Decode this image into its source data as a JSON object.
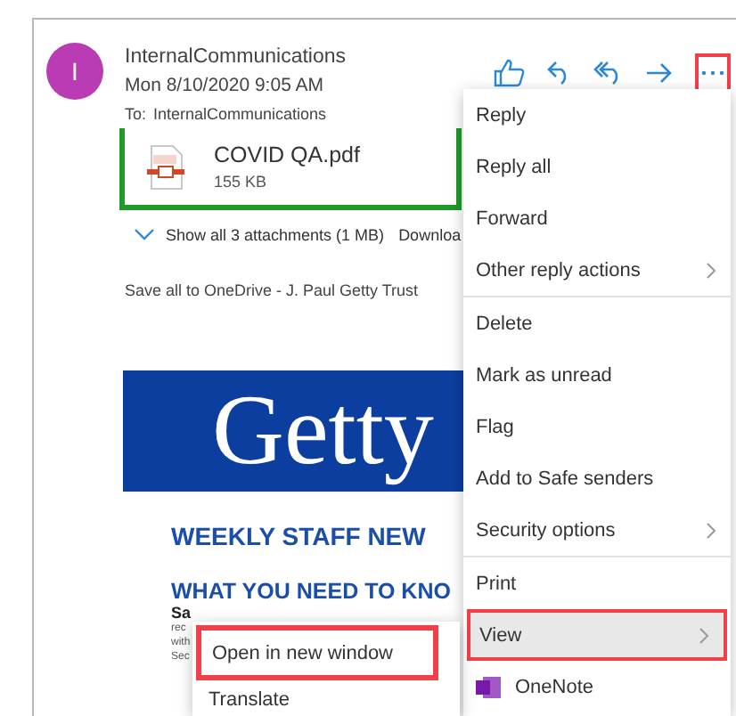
{
  "message": {
    "avatar_initial": "I",
    "sender": "InternalCommunications",
    "date": "Mon 8/10/2020 9:05 AM",
    "to_label": "To:",
    "to": "InternalCommunications"
  },
  "more_button": {
    "highlighted": true
  },
  "attachment": {
    "name": "COVID QA.pdf",
    "size": "155 KB",
    "highlighted": true
  },
  "attachments_link": "Show all 3 attachments (1 MB)",
  "download_link": "Downloa",
  "save_all": "Save all to OneDrive - J. Paul Getty Trust",
  "banner": "Getty",
  "heading": "WEEKLY STAFF NEW",
  "subheading": "WHAT YOU NEED TO KNO",
  "body_lines": [
    {
      "text": "Sa",
      "bold": true
    },
    {
      "text": "rec",
      "bold": false
    },
    {
      "text": "with",
      "bold": false
    },
    {
      "text": "Sec",
      "bold": false
    }
  ],
  "menu": {
    "groups": [
      [
        {
          "label": "Reply",
          "submenu": false,
          "highlighted": false,
          "kind": "text"
        },
        {
          "label": "Reply all",
          "submenu": false,
          "highlighted": false,
          "kind": "text"
        },
        {
          "label": "Forward",
          "submenu": false,
          "highlighted": false,
          "kind": "text"
        },
        {
          "label": "Other reply actions",
          "submenu": true,
          "highlighted": false,
          "kind": "text"
        }
      ],
      [
        {
          "label": "Delete",
          "submenu": false,
          "highlighted": false,
          "kind": "text"
        },
        {
          "label": "Mark as unread",
          "submenu": false,
          "highlighted": false,
          "kind": "text"
        },
        {
          "label": "Flag",
          "submenu": false,
          "highlighted": false,
          "kind": "text"
        },
        {
          "label": "Add to Safe senders",
          "submenu": false,
          "highlighted": false,
          "kind": "text"
        },
        {
          "label": "Security options",
          "submenu": true,
          "highlighted": false,
          "kind": "text"
        }
      ],
      [
        {
          "label": "Print",
          "submenu": false,
          "highlighted": false,
          "kind": "text"
        },
        {
          "label": "View",
          "submenu": true,
          "highlighted": true,
          "kind": "text"
        },
        {
          "label": "OneNote",
          "submenu": false,
          "highlighted": false,
          "kind": "app"
        }
      ]
    ]
  },
  "submenu": [
    {
      "label": "Open in new window",
      "highlighted": true
    },
    {
      "label": "Translate",
      "highlighted": false
    }
  ]
}
